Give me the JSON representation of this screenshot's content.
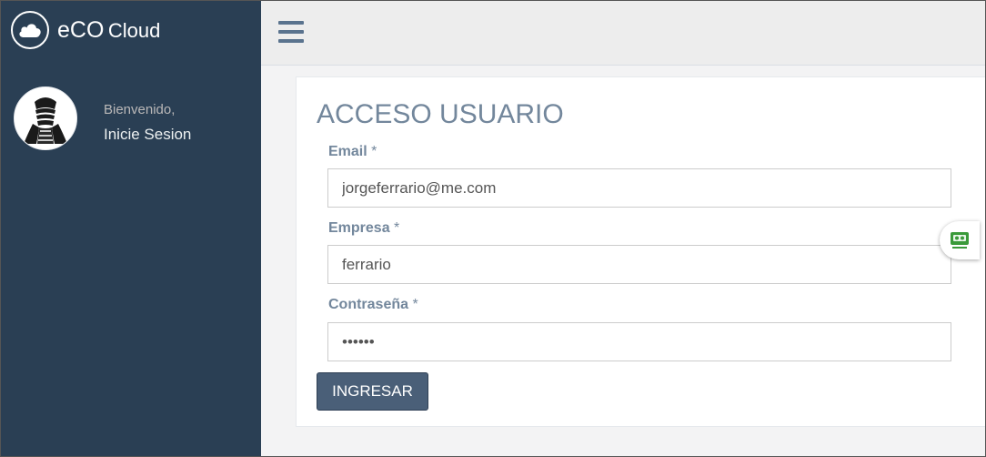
{
  "app": {
    "brand_name": "eCO",
    "brand_sub": "Cloud"
  },
  "sidebar": {
    "welcome": "Bienvenido,",
    "login_link": "Inicie Sesion"
  },
  "form": {
    "title": "ACCESO USUARIO",
    "email": {
      "label": "Email",
      "required_mark": "*",
      "value": "jorgeferrario@me.com"
    },
    "company": {
      "label": "Empresa",
      "required_mark": "*",
      "value": "ferrario"
    },
    "password": {
      "label": "Contraseña",
      "required_mark": "*",
      "value": "••••••"
    },
    "submit_label": "INGRESAR"
  },
  "colors": {
    "sidebar_bg": "#2a3f54",
    "accent": "#73879c",
    "button_bg": "#4a5f78",
    "extension_green": "#3a9a3a"
  },
  "icons": {
    "brand": "cloud-icon",
    "menu": "hamburger-menu-icon",
    "extension": "robot-extension-icon"
  }
}
